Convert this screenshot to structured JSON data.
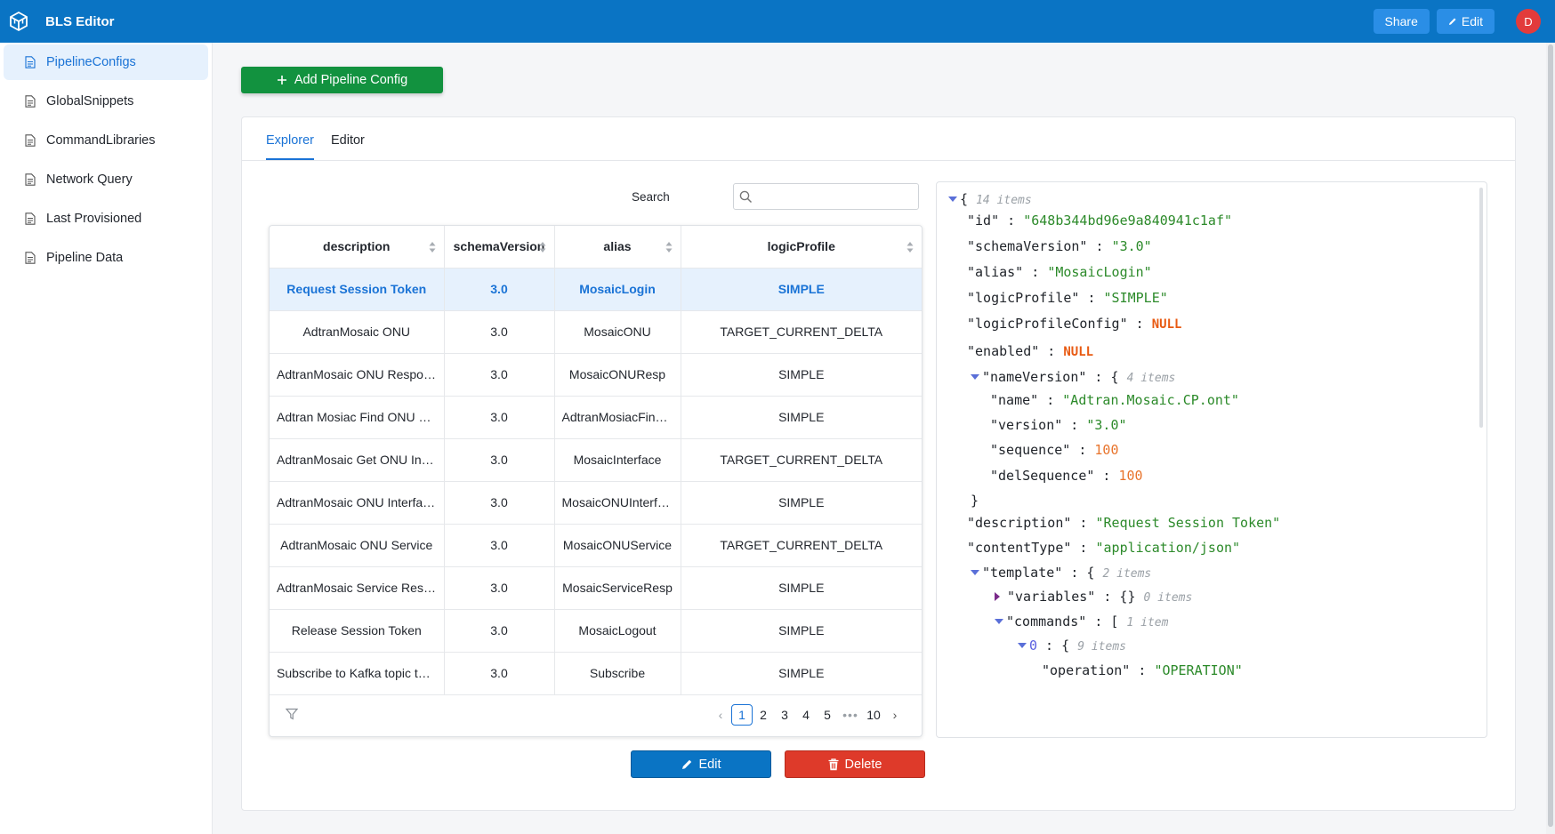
{
  "app": {
    "title": "BLS Editor"
  },
  "topbar": {
    "share_label": "Share",
    "edit_label": "Edit",
    "avatar_initial": "D"
  },
  "sidebar": {
    "items": [
      {
        "label": "PipelineConfigs",
        "active": true
      },
      {
        "label": "GlobalSnippets"
      },
      {
        "label": "CommandLibraries"
      },
      {
        "label": "Network Query"
      },
      {
        "label": "Last Provisioned"
      },
      {
        "label": "Pipeline Data"
      }
    ]
  },
  "main": {
    "add_button_label": "Add Pipeline Config",
    "tabs": [
      {
        "label": "Explorer",
        "active": true
      },
      {
        "label": "Editor"
      }
    ],
    "search": {
      "label": "Search",
      "value": "",
      "placeholder": ""
    },
    "table": {
      "columns": [
        "description",
        "schemaVersion",
        "alias",
        "logicProfile"
      ],
      "rows": [
        [
          "Request Session Token",
          "3.0",
          "MosaicLogin",
          "SIMPLE"
        ],
        [
          "AdtranMosaic ONU",
          "3.0",
          "MosaicONU",
          "TARGET_CURRENT_DELTA"
        ],
        [
          "AdtranMosaic ONU Response",
          "3.0",
          "MosaicONUResp",
          "SIMPLE"
        ],
        [
          "Adtran Mosiac Find ONU Ser...",
          "3.0",
          "AdtranMosiacFindO...",
          "SIMPLE"
        ],
        [
          "AdtranMosaic Get ONU Interf...",
          "3.0",
          "MosaicInterface",
          "TARGET_CURRENT_DELTA"
        ],
        [
          "AdtranMosaic ONU Interface ...",
          "3.0",
          "MosaicONUInterfac...",
          "SIMPLE"
        ],
        [
          "AdtranMosaic ONU Service",
          "3.0",
          "MosaicONUService",
          "TARGET_CURRENT_DELTA"
        ],
        [
          "AdtranMosaic Service Respo...",
          "3.0",
          "MosaicServiceResp",
          "SIMPLE"
        ],
        [
          "Release Session Token",
          "3.0",
          "MosaicLogout",
          "SIMPLE"
        ],
        [
          "Subscribe to Kafka topic to r...",
          "3.0",
          "Subscribe",
          "SIMPLE"
        ]
      ],
      "selected_row": 0,
      "pagination": {
        "pages": [
          "1",
          "2",
          "3",
          "4",
          "5"
        ],
        "ellipsis": "•••",
        "last": "10",
        "current": "1"
      }
    },
    "edit_label": "Edit",
    "delete_label": "Delete"
  },
  "json_view": {
    "root_count": "14 items",
    "id": "\"648b344bd96e9a840941c1af\"",
    "schemaVersion": "\"3.0\"",
    "alias": "\"MosaicLogin\"",
    "logicProfile": "\"SIMPLE\"",
    "logicProfileConfig": "NULL",
    "enabled": "NULL",
    "nameVersion_count": "4 items",
    "name": "\"Adtran.Mosaic.CP.ont\"",
    "version": "\"3.0\"",
    "sequence": "100",
    "delSequence": "100",
    "description": "\"Request Session Token\"",
    "contentType": "\"application/json\"",
    "template_count": "2 items",
    "variables_count": "0 items",
    "commands_count": "1 item",
    "cmd0_count": "9 items",
    "operation": "\"OPERATION\"",
    "keys": {
      "id": "\"id\"",
      "schemaVersion": "\"schemaVersion\"",
      "alias": "\"alias\"",
      "logicProfile": "\"logicProfile\"",
      "logicProfileConfig": "\"logicProfileConfig\"",
      "enabled": "\"enabled\"",
      "nameVersion": "\"nameVersion\"",
      "name": "\"name\"",
      "version": "\"version\"",
      "sequence": "\"sequence\"",
      "delSequence": "\"delSequence\"",
      "description": "\"description\"",
      "contentType": "\"contentType\"",
      "template": "\"template\"",
      "variables": "\"variables\"",
      "commands": "\"commands\"",
      "operation": "\"operation\""
    }
  },
  "colors": {
    "primary": "#0a74c4",
    "success": "#12923f",
    "danger": "#de3a2a",
    "selected_bg": "#e6f1fd",
    "string": "#2c8a2a",
    "number": "#e8742c"
  }
}
